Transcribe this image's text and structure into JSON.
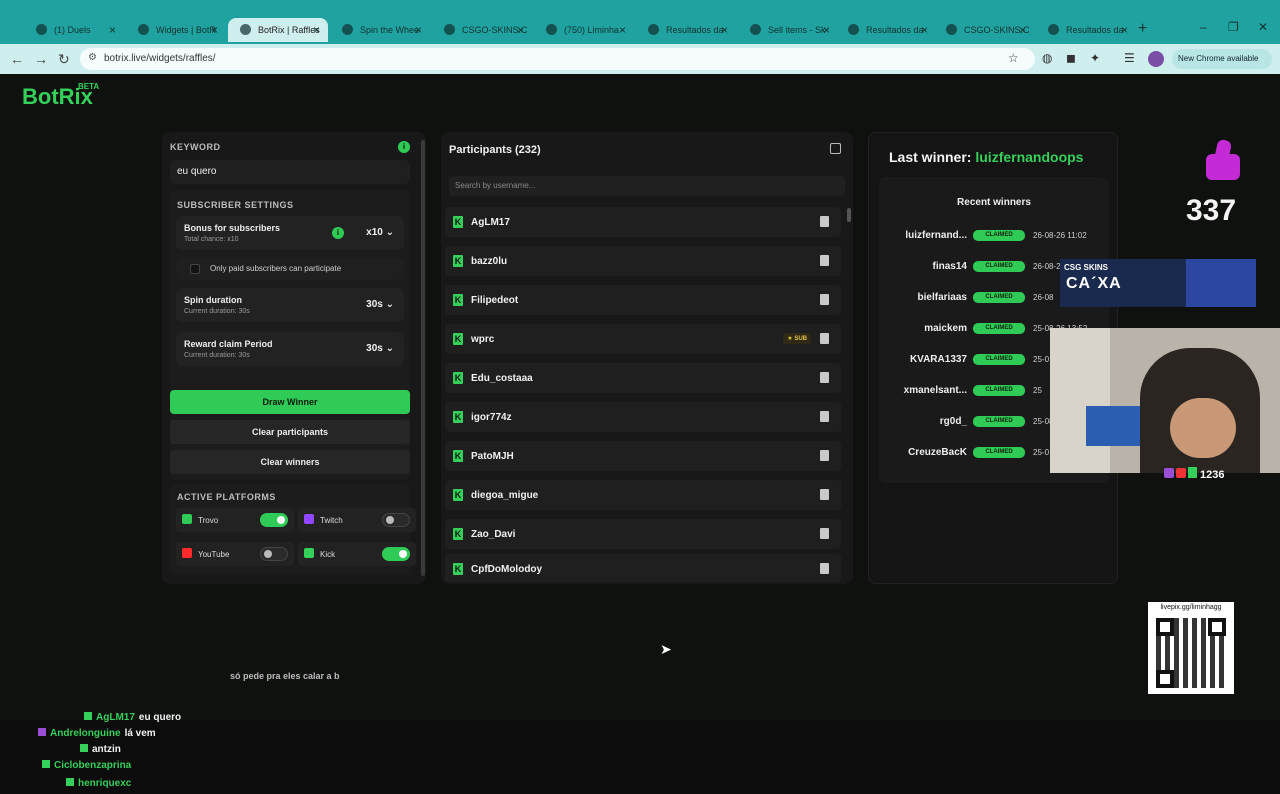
{
  "browser": {
    "tabs": [
      {
        "label": "(1) Duels",
        "active": false
      },
      {
        "label": "Widgets | BotR",
        "active": false
      },
      {
        "label": "BotRix | Raffles",
        "active": true
      },
      {
        "label": "Spin the Whee",
        "active": false
      },
      {
        "label": "CSGO-SKINS.C",
        "active": false
      },
      {
        "label": "(750) Liminha",
        "active": false
      },
      {
        "label": "Resultados da",
        "active": false
      },
      {
        "label": "Sell items - Sk",
        "active": false
      },
      {
        "label": "Resultados da",
        "active": false
      },
      {
        "label": "CSGO-SKINS.C",
        "active": false
      },
      {
        "label": "Resultados da",
        "active": false
      }
    ],
    "url": "botrix.live/widgets/raffles/",
    "update_label": "New Chrome available"
  },
  "logo": {
    "name": "BotRix",
    "badge": "BETA"
  },
  "settings": {
    "keyword_label": "KEYWORD",
    "keyword_value": "eu quero",
    "subscriber_settings_label": "SUBSCRIBER SETTINGS",
    "bonus_title": "Bonus for subscribers",
    "bonus_sub": "Total chance: x10",
    "bonus_value": "x10",
    "paid_only_label": "Only paid subscribers can participate",
    "spin_title": "Spin duration",
    "spin_sub": "Current duration: 30s",
    "spin_value": "30s",
    "claim_title": "Reward claim Period",
    "claim_sub": "Current duration: 30s",
    "claim_value": "30s",
    "draw_button": "Draw Winner",
    "clear_participants_button": "Clear participants",
    "clear_winners_button": "Clear winners",
    "platforms_label": "ACTIVE PLATFORMS",
    "platforms": [
      {
        "name": "Trovo",
        "on": true,
        "color": "#2fcb56"
      },
      {
        "name": "Twitch",
        "on": false,
        "color": "#9146ff"
      },
      {
        "name": "YouTube",
        "on": false,
        "color": "#ff2b2b"
      },
      {
        "name": "Kick",
        "on": true,
        "color": "#35d05a"
      }
    ]
  },
  "participants": {
    "title": "Participants (232)",
    "search_placeholder": "Search by username...",
    "rows": [
      {
        "name": "AgLM17",
        "sub": ""
      },
      {
        "name": "bazz0lu",
        "sub": ""
      },
      {
        "name": "Filipedeot",
        "sub": ""
      },
      {
        "name": "wprc",
        "sub": "★ SUB"
      },
      {
        "name": "Edu_costaaa",
        "sub": ""
      },
      {
        "name": "igor774z",
        "sub": ""
      },
      {
        "name": "PatoMJH",
        "sub": ""
      },
      {
        "name": "diegoa_migue",
        "sub": ""
      },
      {
        "name": "Zao_Davi",
        "sub": ""
      },
      {
        "name": "CpfDoMolodoy",
        "sub": ""
      }
    ]
  },
  "winners": {
    "last_winner_label": "Last winner:",
    "last_winner_name": "luizfernandoops",
    "recent_title": "Recent winners",
    "rows": [
      {
        "name": "luizfernand...",
        "status": "CLAIMED",
        "date": "26-08-26 11:02"
      },
      {
        "name": "finas14",
        "status": "CLAIMED",
        "date": "26-08-26"
      },
      {
        "name": "bielfariaas",
        "status": "CLAIMED",
        "date": "26-08"
      },
      {
        "name": "maickem",
        "status": "CLAIMED",
        "date": "25-08-26 13:52"
      },
      {
        "name": "KVARA1337",
        "status": "CLAIMED",
        "date": "25-0"
      },
      {
        "name": "xmanelsant...",
        "status": "CLAIMED",
        "date": "25"
      },
      {
        "name": "rg0d_",
        "status": "CLAIMED",
        "date": "25-08"
      },
      {
        "name": "CreuzeBacK",
        "status": "CLAIMED",
        "date": "25-0"
      }
    ]
  },
  "overlay": {
    "like_count": "337",
    "csg_brand": "CSG SKINS",
    "csg_promo": "CA´XA",
    "viewer_count": "1236",
    "qr_label": "livepix.gg/liminhagg"
  },
  "chat": [
    {
      "name": "AgLM17",
      "msg": "eu quero"
    },
    {
      "name": "Andrelonguine",
      "msg": "lá vem"
    },
    {
      "name": "antzin",
      "msg": ""
    },
    {
      "name": "Ciclobenzaprina",
      "msg": ""
    },
    {
      "name": "henriquexc",
      "msg": ""
    }
  ],
  "floating_message": "só pede pra eles calar a b"
}
